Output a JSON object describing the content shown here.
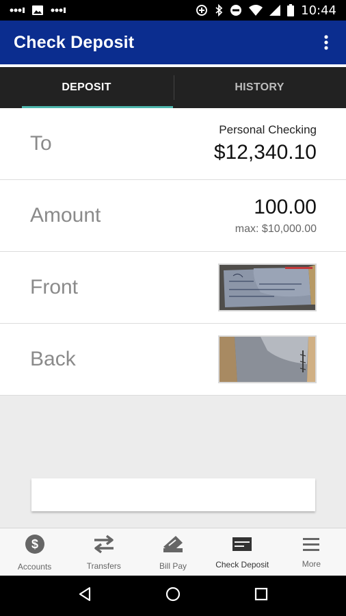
{
  "status_bar": {
    "time": "10:44"
  },
  "app_bar": {
    "title": "Check Deposit"
  },
  "tabs": [
    {
      "label": "DEPOSIT",
      "active": true
    },
    {
      "label": "HISTORY",
      "active": false
    }
  ],
  "form": {
    "to": {
      "label": "To",
      "account_name": "Personal Checking",
      "balance": "$12,340.10"
    },
    "amount": {
      "label": "Amount",
      "value": "100.00",
      "max": "max: $10,000.00"
    },
    "front": {
      "label": "Front"
    },
    "back": {
      "label": "Back"
    }
  },
  "bottom_nav": [
    {
      "label": "Accounts",
      "icon": "dollar-circle-icon"
    },
    {
      "label": "Transfers",
      "icon": "transfer-arrows-icon"
    },
    {
      "label": "Bill Pay",
      "icon": "bill-pay-icon"
    },
    {
      "label": "Check Deposit",
      "icon": "check-deposit-icon",
      "active": true
    },
    {
      "label": "More",
      "icon": "hamburger-menu-icon"
    }
  ],
  "colors": {
    "app_bar": "#0b2d8f",
    "tab_indicator": "#4db6ac",
    "tabs_bg": "#222222"
  }
}
